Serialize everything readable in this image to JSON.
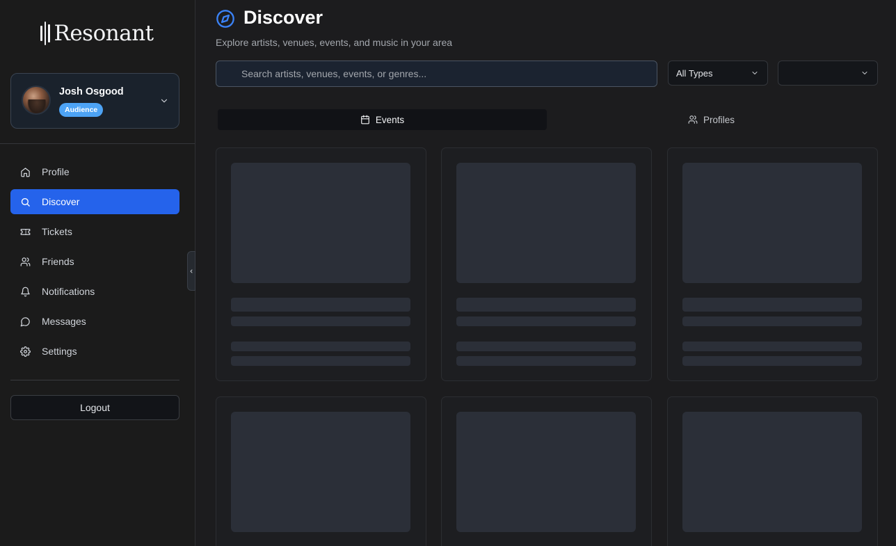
{
  "brand": {
    "name": "Resonant"
  },
  "user": {
    "name": "Josh Osgood",
    "role": "Audience"
  },
  "nav": {
    "items": [
      {
        "label": "Profile",
        "icon": "home-icon",
        "active": false
      },
      {
        "label": "Discover",
        "icon": "search-icon",
        "active": true
      },
      {
        "label": "Tickets",
        "icon": "ticket-icon",
        "active": false
      },
      {
        "label": "Friends",
        "icon": "users-icon",
        "active": false
      },
      {
        "label": "Notifications",
        "icon": "bell-icon",
        "active": false
      },
      {
        "label": "Messages",
        "icon": "message-circle-icon",
        "active": false
      },
      {
        "label": "Settings",
        "icon": "gear-icon",
        "active": false
      }
    ],
    "logout_label": "Logout"
  },
  "header": {
    "title": "Discover",
    "subtitle": "Explore artists, venues, events, and music in your area",
    "icon": "compass-icon"
  },
  "search": {
    "placeholder": "Search artists, venues, events, or genres...",
    "value": ""
  },
  "filters": {
    "type_selected": "All Types",
    "second_selected": ""
  },
  "tabs": [
    {
      "label": "Events",
      "icon": "calendar-icon",
      "active": true
    },
    {
      "label": "Profiles",
      "icon": "users-icon",
      "active": false
    }
  ],
  "colors": {
    "accent": "#2563eb",
    "badge": "#4da3f5",
    "compass": "#3b82f6",
    "skeleton": "#2b2f38"
  }
}
